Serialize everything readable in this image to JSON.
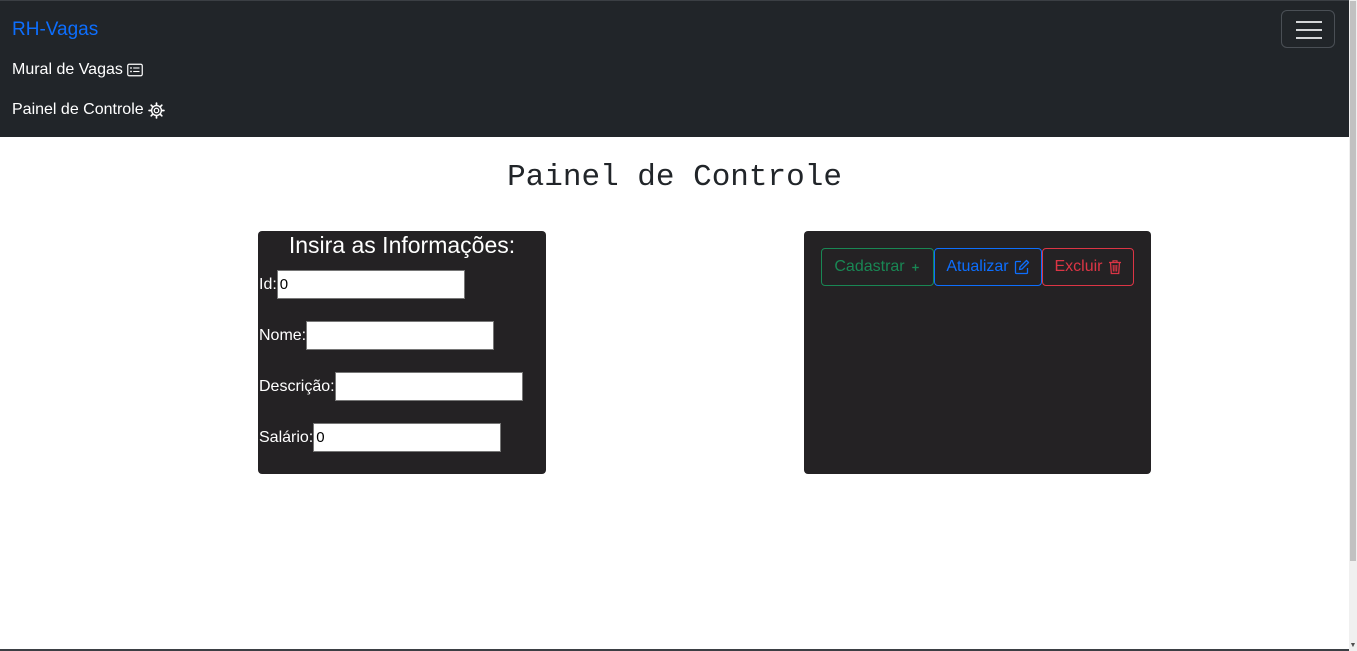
{
  "navbar": {
    "brand": "RH-Vagas",
    "toggler_icon": "hamburger-menu-icon",
    "links": [
      {
        "label": "Mural de Vagas",
        "icon": "card-list-icon"
      },
      {
        "label": "Painel de Controle",
        "icon": "gear-icon"
      }
    ]
  },
  "main": {
    "title": "Painel de Controle"
  },
  "form": {
    "heading": "Insira as Informações:",
    "fields": [
      {
        "label": "Id:",
        "value": "0"
      },
      {
        "label": "Nome:",
        "value": ""
      },
      {
        "label": "Descrição:",
        "value": ""
      },
      {
        "label": "Salário:",
        "value": "0"
      }
    ]
  },
  "actions": {
    "cadastrar": {
      "label": "Cadastrar",
      "icon": "plus-icon",
      "color": "#198754"
    },
    "atualizar": {
      "label": "Atualizar",
      "icon": "pencil-square-icon",
      "color": "#0d6efd"
    },
    "excluir": {
      "label": "Excluir",
      "icon": "trash-icon",
      "color": "#dc3545"
    }
  },
  "colors": {
    "navbar_bg": "#212529",
    "panel_bg": "#242224",
    "brand": "#0d6efd"
  }
}
